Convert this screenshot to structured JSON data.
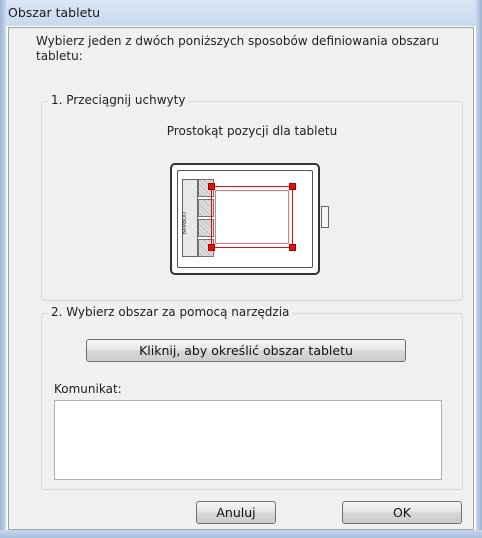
{
  "window": {
    "title": "Obszar tabletu"
  },
  "intro": "Wybierz jeden z dwóch poniższych sposobów definiowania obszaru tabletu:",
  "section1": {
    "legend": "1. Przeciągnij uchwyty",
    "caption": "Prostokąt pozycji dla tabletu",
    "tablet_brand": "BAMBOO"
  },
  "section2": {
    "legend": "2. Wybierz obszar za pomocą narzędzia",
    "tool_button": "Kliknij, aby określić obszar tabletu",
    "message_label": "Komunikat:",
    "message_value": ""
  },
  "buttons": {
    "cancel": "Anuluj",
    "ok": "OK"
  },
  "colors": {
    "selection": "#e01010",
    "titlebar": "#c9d9ee",
    "client_bg": "#f0f0f0"
  }
}
